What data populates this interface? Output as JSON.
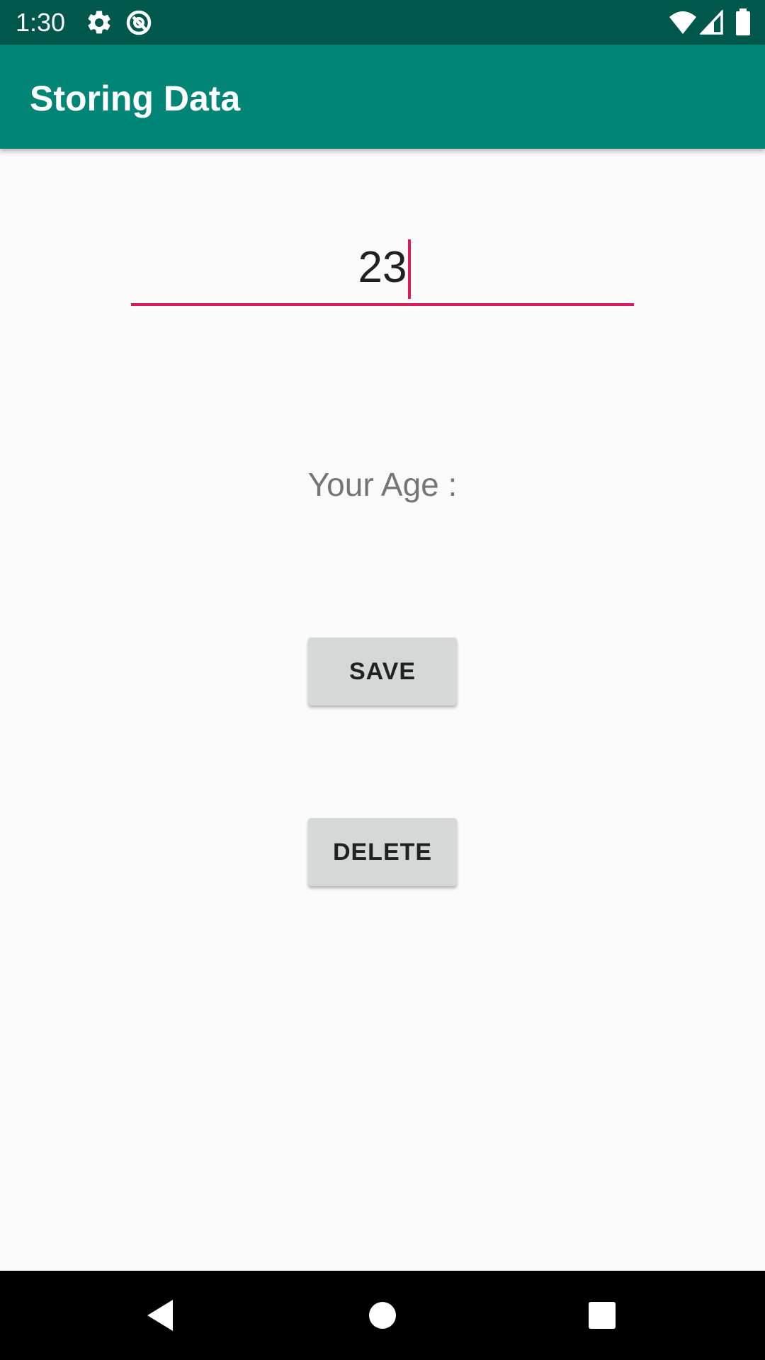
{
  "status_bar": {
    "time": "1:30",
    "icons": [
      "gear-icon",
      "data-saver-icon",
      "wifi-icon",
      "cell-signal-icon",
      "battery-icon"
    ],
    "background": "#00574b"
  },
  "app_bar": {
    "title": "Storing Data",
    "background": "#008577"
  },
  "age_input": {
    "value": "23",
    "accent": "#d81b60"
  },
  "age_label": {
    "text": "Your Age :"
  },
  "buttons": {
    "save_label": "SAVE",
    "delete_label": "DELETE"
  },
  "nav_bar": {
    "icons": [
      "back-icon",
      "home-icon",
      "recents-icon"
    ]
  }
}
